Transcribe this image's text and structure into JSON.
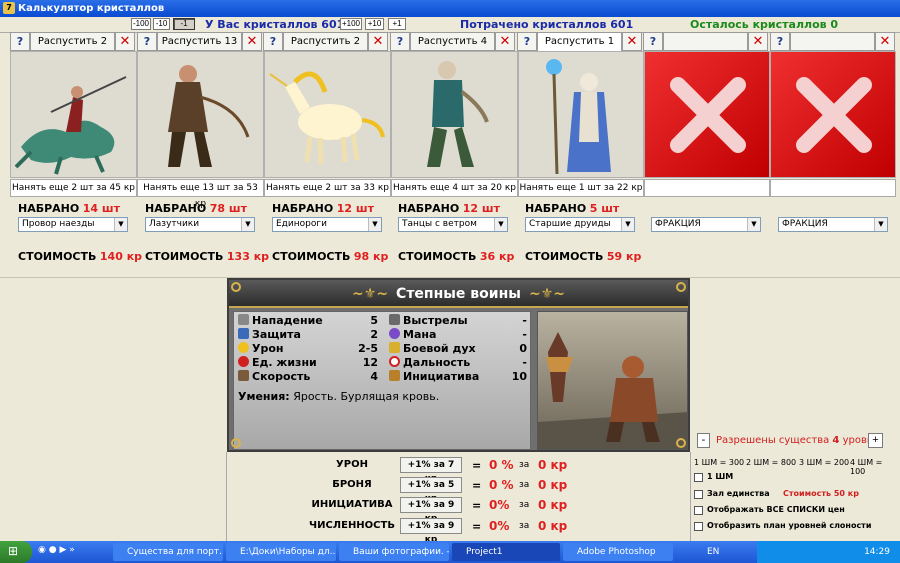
{
  "window": {
    "title": "Калькулятор кристаллов"
  },
  "top": {
    "minus_buttons": [
      "-100",
      "-10",
      "-1"
    ],
    "plus_buttons": [
      "+100",
      "+10",
      "+1"
    ],
    "have_label": "У Вас кристаллов 601",
    "spent_label": "Потрачено кристаллов 601",
    "left_label": "Осталось кристаллов 0"
  },
  "slots": [
    {
      "dismiss": "Распустить 2 шт",
      "hire": "Нанять еще 2 шт за 45 кр",
      "count_label": "НАБРАНО",
      "count": "14 шт",
      "unit": "Провор наезды",
      "cost_label": "СТОИМОСТЬ",
      "cost": "140 кр"
    },
    {
      "dismiss": "Распустить 13 шт",
      "hire": "Нанять еще 13 шт за 53 кр",
      "count_label": "НАБРАНО",
      "count": "78 шт",
      "unit": "Лазутчики",
      "cost_label": "СТОИМОСТЬ",
      "cost": "133 кр"
    },
    {
      "dismiss": "Распустить 2 шт",
      "hire": "Нанять еще 2 шт за 33 кр",
      "count_label": "НАБРАНО",
      "count": "12 шт",
      "unit": "Единороги",
      "cost_label": "СТОИМОСТЬ",
      "cost": "98 кр"
    },
    {
      "dismiss": "Распустить 4 шт",
      "hire": "Нанять еще 4 шт за 20 кр",
      "count_label": "НАБРАНО",
      "count": "12 шт",
      "unit": "Танцы с ветром",
      "cost_label": "СТОИМОСТЬ",
      "cost": "36 кр"
    },
    {
      "dismiss": "Распустить 1 шт",
      "hire": "Нанять еще 1 шт за 22 кр",
      "count_label": "НАБРАНО",
      "count": "5 шт",
      "unit": "Старшие друиды",
      "cost_label": "СТОИМОСТЬ",
      "cost": "59 кр"
    },
    {
      "dismiss": "",
      "hire": "",
      "unit": "ФРАКЦИЯ"
    },
    {
      "dismiss": "",
      "hire": "",
      "unit": "ФРАКЦИЯ"
    }
  ],
  "info": {
    "title": "Степные воины",
    "stats_left": [
      {
        "label": "Нападение",
        "value": "5"
      },
      {
        "label": "Защита",
        "value": "2"
      },
      {
        "label": "Урон",
        "value": "2-5"
      },
      {
        "label": "Ед. жизни",
        "value": "12"
      },
      {
        "label": "Скорость",
        "value": "4"
      }
    ],
    "stats_right": [
      {
        "label": "Выстрелы",
        "value": "-"
      },
      {
        "label": "Мана",
        "value": "-"
      },
      {
        "label": "Боевой дух",
        "value": "0"
      },
      {
        "label": "Дальность",
        "value": "-"
      },
      {
        "label": "Инициатива",
        "value": "10"
      }
    ],
    "skills_label": "Умения:",
    "skills": "Ярость.  Бурлящая кровь."
  },
  "levels": {
    "minus": "-",
    "label": "Разрешены существа",
    "level": "4",
    "suffix": "уровня",
    "plus": "+"
  },
  "upgrades": [
    {
      "label": "УРОН",
      "button": "+1% за 7 кр",
      "eq": "=",
      "pct": "0 %",
      "za": "за",
      "cost": "0 кр"
    },
    {
      "label": "БРОНЯ",
      "button": "+1% за 5 кр",
      "eq": "=",
      "pct": "0 %",
      "za": "за",
      "cost": "0 кр"
    },
    {
      "label": "ИНИЦИАТИВА",
      "button": "+1% за 9 кр",
      "eq": "=",
      "pct": "0%",
      "za": "за",
      "cost": "0 кр"
    },
    {
      "label": "ЧИСЛЕННОСТЬ",
      "button": "+1% за 9 кр",
      "eq": "=",
      "pct": "0%",
      "za": "за",
      "cost": "0 кр"
    }
  ],
  "options": {
    "rates": [
      "1 ШМ = 300",
      "2 ШМ = 800",
      "3 ШМ = 200",
      "4 ШМ = 100"
    ],
    "checks": [
      "1 ШМ",
      "Зал единства",
      "Отображать ВСЕ СПИСКИ цен",
      "Отобразить план уровней слоности"
    ],
    "unity_cost": "Стоимость 50 кр"
  },
  "taskbar": {
    "items": [
      "Существа для порт...",
      "E:\\Доки\\Наборы дл...",
      "Ваши фотографии. -...",
      "Project1",
      "Adobe Photoshop"
    ],
    "lang": "EN",
    "clock": "14:29"
  }
}
